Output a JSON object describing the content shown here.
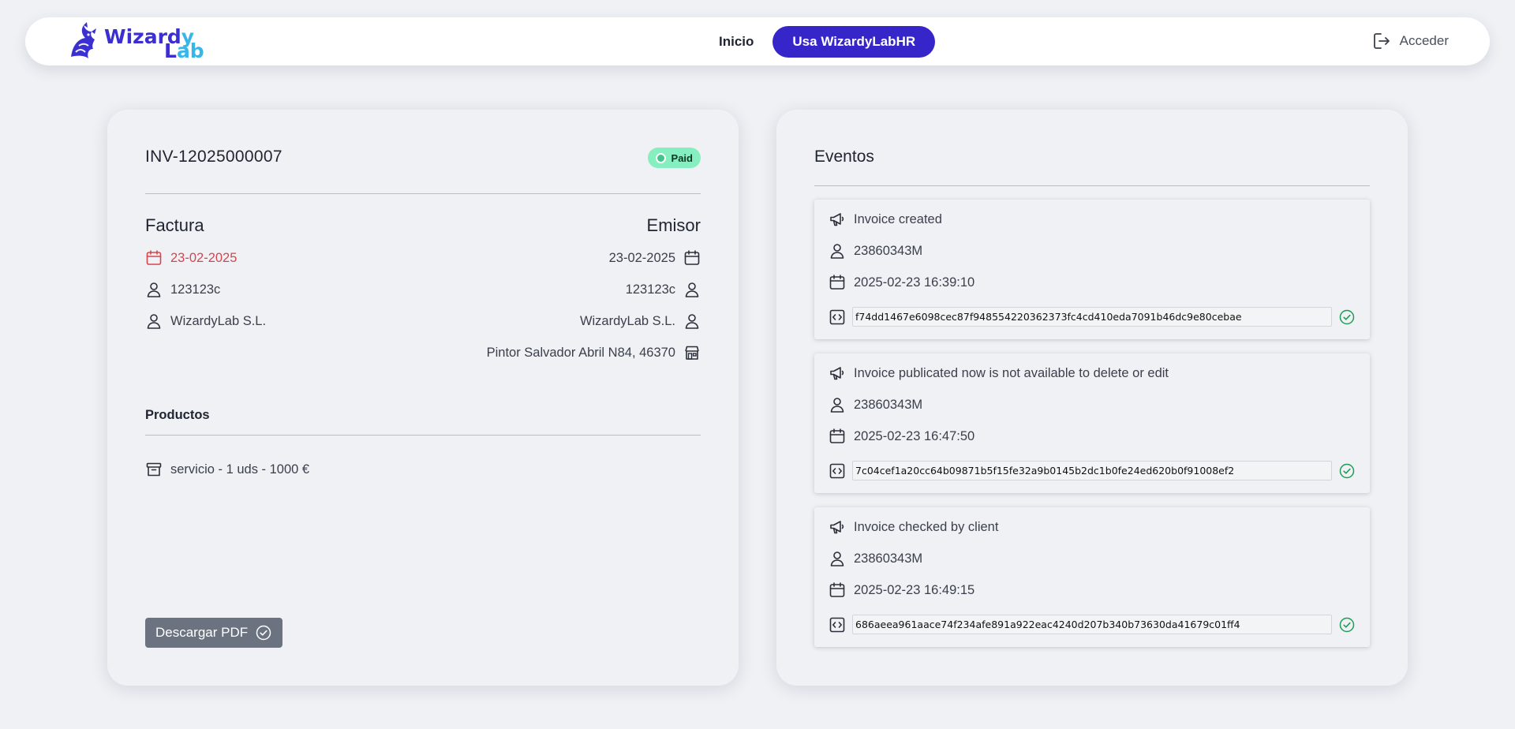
{
  "nav": {
    "logo_part1": "Wizard",
    "logo_part1_y": "y",
    "logo_part2_L": "L",
    "logo_part2_ab": "ab",
    "links": [
      {
        "label": "Inicio"
      }
    ],
    "cta_label": "Usa WizardyLabHR",
    "login_label": "Acceder"
  },
  "invoice": {
    "id": "INV-12025000007",
    "status": "Paid",
    "factura": {
      "heading": "Factura",
      "date": "23-02-2025",
      "client_id": "123123c",
      "company": "WizardyLab S.L."
    },
    "emisor": {
      "heading": "Emisor",
      "date": "23-02-2025",
      "client_id": "123123c",
      "company": "WizardyLab S.L.",
      "address": "Pintor Salvador Abril N84, 46370"
    },
    "products_heading": "Productos",
    "products": [
      {
        "label": "servicio - 1 uds - 1000 €"
      }
    ],
    "download_label": "Descargar PDF"
  },
  "events": {
    "title": "Eventos",
    "items": [
      {
        "message": "Invoice created",
        "user": "23860343M",
        "timestamp": "2025-02-23 16:39:10",
        "hash": "f74dd1467e6098cec87f948554220362373fc4cd410eda7091b46dc9e80cebae"
      },
      {
        "message": "Invoice publicated now is not available to delete or edit",
        "user": "23860343M",
        "timestamp": "2025-02-23 16:47:50",
        "hash": "7c04cef1a20cc64b09871b5f15fe32a9b0145b2dc1b0fe24ed620b0f91008ef2"
      },
      {
        "message": "Invoice checked by client",
        "user": "23860343M",
        "timestamp": "2025-02-23 16:49:15",
        "hash": "686aeea961aace74f234afe891a922eac4240d207b340b73630da41679c01ff4"
      }
    ]
  },
  "colors": {
    "accent": "#3626c9",
    "badge_bg": "#86efc0",
    "date_red": "#d64550",
    "verified_green": "#1f9d55"
  }
}
